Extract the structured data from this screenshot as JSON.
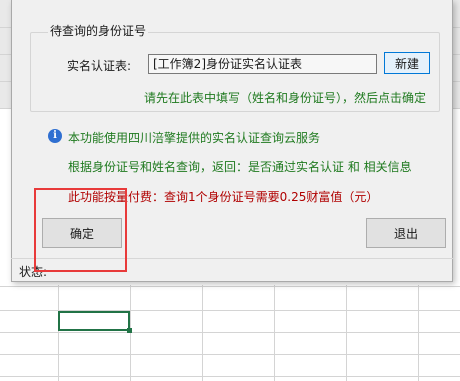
{
  "group": {
    "title": "待查询的身份证号",
    "table_label": "实名认证表:",
    "table_value": "[工作簿2]身份证实名认证表",
    "new_button": "新建",
    "hint": "请先在此表中填写（姓名和身份证号），然后点击确定"
  },
  "info": {
    "icon": "info-icon",
    "line1": "本功能使用四川涪擎提供的实名认证查询云服务",
    "line2": "根据身份证号和姓名查询，返回：是否通过实名认证 和 相关信息",
    "line3": "此功能按量付费：查询1个身份证号需要0.25财富值（元）"
  },
  "buttons": {
    "confirm": "确定",
    "exit": "退出"
  },
  "status_label": "状态:",
  "colors": {
    "green_text": "#1f7a1f",
    "red_text": "#b00000",
    "highlight": "#e83a3a",
    "selection": "#217346"
  }
}
